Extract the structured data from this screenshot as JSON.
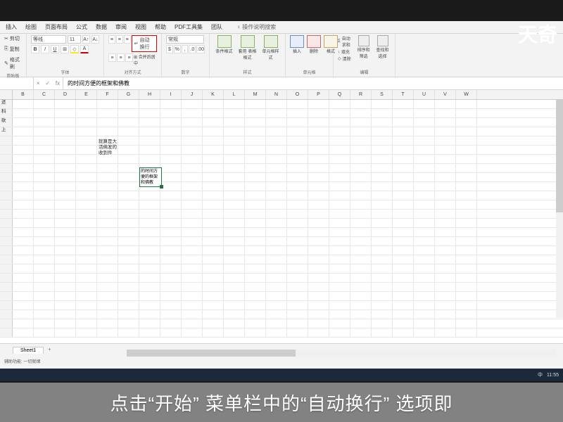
{
  "watermark": "天奇",
  "tabs": {
    "t1": "插入",
    "t2": "绘图",
    "t3": "页面布局",
    "t4": "公式",
    "t5": "数据",
    "t6": "审阅",
    "t7": "视图",
    "t8": "帮助",
    "t9": "PDF工具集",
    "t10": "团队",
    "tellme": "操作说明搜索"
  },
  "clipboard": {
    "cut": "剪切",
    "copy": "复制",
    "paste": "格式刷",
    "label": "剪贴板"
  },
  "font": {
    "name": "等线",
    "size": "11",
    "label": "字体"
  },
  "align": {
    "wrap": "自动换行",
    "merge": "合并后居中",
    "label": "对齐方式"
  },
  "number": {
    "general": "常规",
    "label": "数字"
  },
  "styles": {
    "cond": "条件格式",
    "table": "套用\n表格格式",
    "cell": "单元格样式",
    "label": "样式"
  },
  "cells": {
    "insert": "插入",
    "delete": "删除",
    "format": "格式",
    "label": "单元格"
  },
  "editing": {
    "sum": "自动求和",
    "fill": "填充",
    "clear": "清除",
    "sort": "排序和筛选",
    "find": "查找和选择",
    "label": "编辑"
  },
  "formula_bar": {
    "cell_ref": "",
    "fx": "fx",
    "value": "的时间方便的框架和佛教"
  },
  "columns": [
    "B",
    "C",
    "D",
    "E",
    "F",
    "G",
    "H",
    "I",
    "J",
    "K",
    "L",
    "M",
    "N",
    "O",
    "P",
    "Q",
    "R",
    "S",
    "T",
    "U",
    "V",
    "W"
  ],
  "content": {
    "a1": "还",
    "a2": "科",
    "a3": "砍",
    "a4": "上",
    "e_text": "就算是大\n活佛发的\n收到件",
    "active_text": "的时间方\n便的框架\n和佛教"
  },
  "sheet": {
    "name": "Sheet1",
    "plus": "+"
  },
  "status": "辅助功能: 一切就绪",
  "taskbar": {
    "ime": "中",
    "time": "11:55"
  },
  "caption": "点击“开始” 菜单栏中的“自动换行” 选项即"
}
